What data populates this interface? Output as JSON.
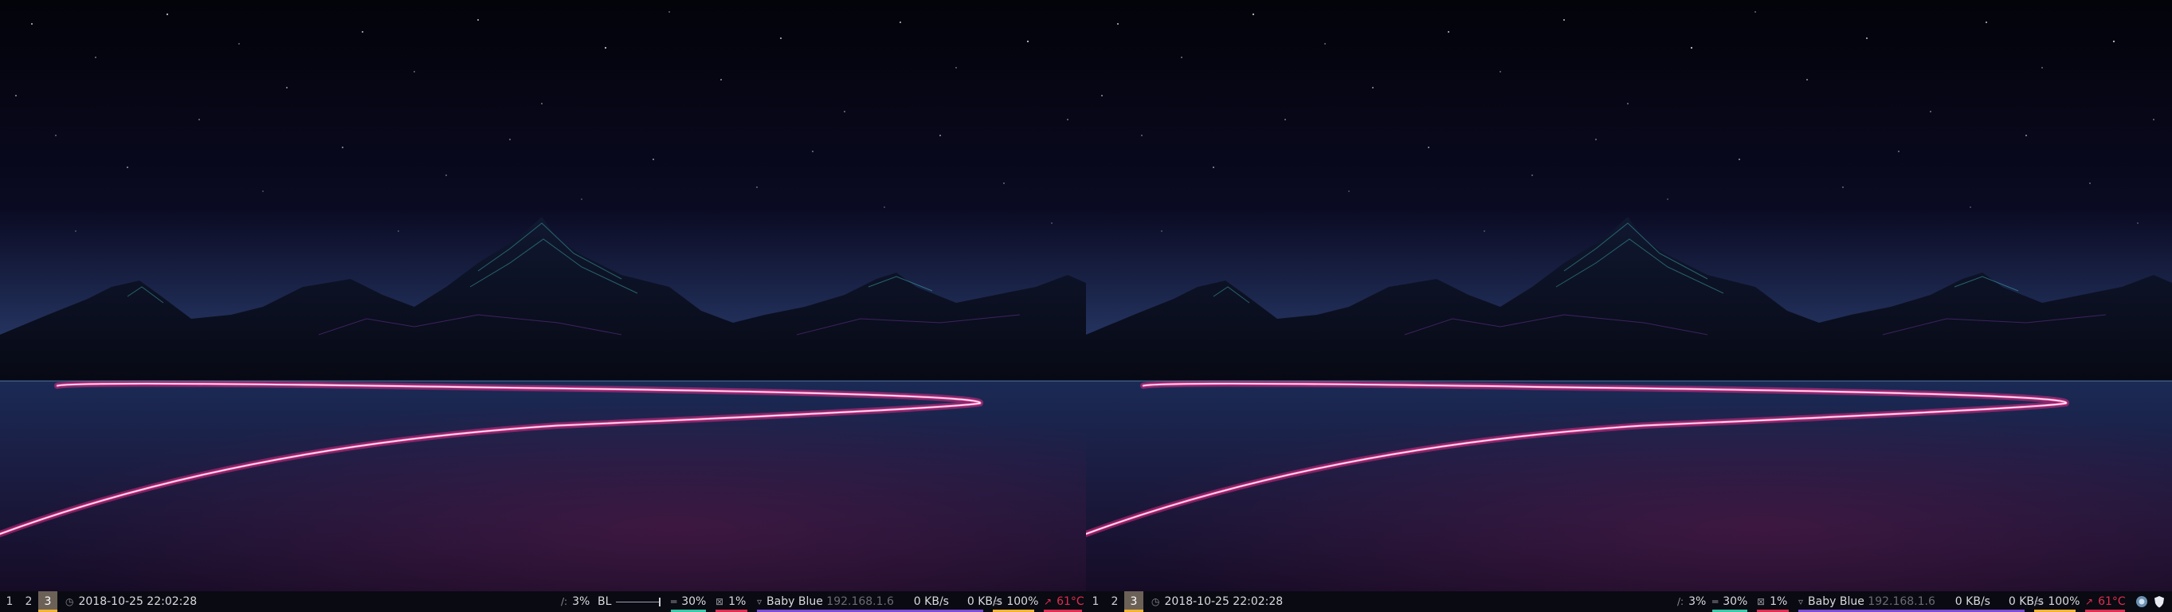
{
  "colors": {
    "bar_background": "#0a0a12",
    "active_workspace": "#6b6157",
    "workspace_underline": "#f2b431",
    "accent_teal": "#37c9a9",
    "accent_red": "#e02d50",
    "accent_purple": "#7c4dd6",
    "accent_yellow": "#f2b431",
    "neon_pink": "#ff2f8f"
  },
  "monitors": [
    {
      "workspaces": [
        {
          "label": "1",
          "active": false
        },
        {
          "label": "2",
          "active": false
        },
        {
          "label": "3",
          "active": true
        }
      ],
      "clock": {
        "icon": "clock-icon",
        "text": "2018-10-25 22:02:28"
      },
      "modules": {
        "cpu": {
          "icon": "cpu-icon",
          "value": "3%"
        },
        "backlight": {
          "label": "BL"
        },
        "memory": {
          "icon": "memory-icon",
          "value": "30%"
        },
        "swap": {
          "icon": "swap-icon",
          "value": "1%"
        },
        "wifi": {
          "icon": "wifi-icon",
          "ssid": "Baby Blue",
          "ip": "192.168.1.6"
        },
        "net_down": {
          "value": "0 KB/s"
        },
        "net_up": {
          "value": "0 KB/s"
        },
        "battery": {
          "icon": "battery-icon",
          "value": "100%"
        },
        "temperature": {
          "icon": "thermometer-icon",
          "value": "61°C"
        }
      }
    },
    {
      "workspaces": [
        {
          "label": "1",
          "active": false
        },
        {
          "label": "2",
          "active": false
        },
        {
          "label": "3",
          "active": true
        }
      ],
      "clock": {
        "icon": "clock-icon",
        "text": "2018-10-25 22:02:28"
      },
      "modules": {
        "cpu": {
          "icon": "cpu-icon",
          "value": "3%"
        },
        "memory": {
          "icon": "memory-icon",
          "value": "30%"
        },
        "swap": {
          "icon": "swap-icon",
          "value": "1%"
        },
        "wifi": {
          "icon": "wifi-icon",
          "ssid": "Baby Blue",
          "ip": "192.168.1.6"
        },
        "net_down": {
          "value": "0 KB/s"
        },
        "net_up": {
          "value": "0 KB/s"
        },
        "battery": {
          "icon": "battery-icon",
          "value": "100%"
        },
        "temperature": {
          "icon": "thermometer-icon",
          "value": "61°C"
        }
      },
      "tray": [
        {
          "icon": "network-manager-icon"
        },
        {
          "icon": "shield-icon"
        }
      ]
    }
  ]
}
